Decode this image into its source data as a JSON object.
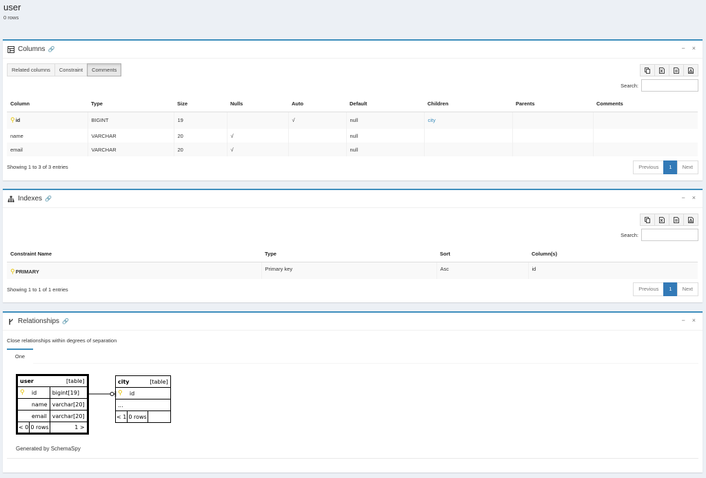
{
  "page": {
    "title": "user",
    "subtitle": "0 rows"
  },
  "columns_box": {
    "title": "Columns",
    "tabs": [
      "Related columns",
      "Constraint",
      "Comments"
    ],
    "search_label": "Search:",
    "headers": [
      "Column",
      "Type",
      "Size",
      "Nulls",
      "Auto",
      "Default",
      "Children",
      "Parents",
      "Comments"
    ],
    "rows": [
      {
        "column": "id",
        "type": "BIGINT",
        "size": "19",
        "nulls": "",
        "auto": "√",
        "default": "null",
        "children": "city",
        "parents": "",
        "comments": ""
      },
      {
        "column": "name",
        "type": "VARCHAR",
        "size": "20",
        "nulls": "√",
        "auto": "",
        "default": "null",
        "children": "",
        "parents": "",
        "comments": ""
      },
      {
        "column": "email",
        "type": "VARCHAR",
        "size": "20",
        "nulls": "√",
        "auto": "",
        "default": "null",
        "children": "",
        "parents": "",
        "comments": ""
      }
    ],
    "info": "Showing 1 to 3 of 3 entries",
    "pager": {
      "prev": "Previous",
      "page": "1",
      "next": "Next"
    }
  },
  "indexes_box": {
    "title": "Indexes",
    "search_label": "Search:",
    "headers": [
      "Constraint Name",
      "Type",
      "Sort",
      "Column(s)"
    ],
    "rows": [
      {
        "name": "PRIMARY",
        "type": "Primary key",
        "sort": "Asc",
        "columns": "id"
      }
    ],
    "info": "Showing 1 to 1 of 1 entries",
    "pager": {
      "prev": "Previous",
      "page": "1",
      "next": "Next"
    }
  },
  "relationships_box": {
    "title": "Relationships",
    "description": "Close relationships within degrees of separation",
    "tab": "One",
    "user_table": {
      "name": "user",
      "kind": "[table]",
      "rows": [
        {
          "col": "id",
          "type": "bigint[19]"
        },
        {
          "col": "name",
          "type": "varchar[20]"
        },
        {
          "col": "email",
          "type": "varchar[20]"
        }
      ],
      "footer_left": "< 0",
      "footer_mid": "0 rows",
      "footer_right": "1 >"
    },
    "city_table": {
      "name": "city",
      "kind": "[table]",
      "col": "id",
      "ellipsis": "...",
      "footer_left": "< 1",
      "footer_mid": "0 rows"
    },
    "generated": "Generated by SchemaSpy"
  },
  "colors": {
    "accent": "#3c8dbc",
    "page_bg": "#ecf0f5",
    "key": "#e6c200",
    "pager_active": "#337ab7"
  }
}
